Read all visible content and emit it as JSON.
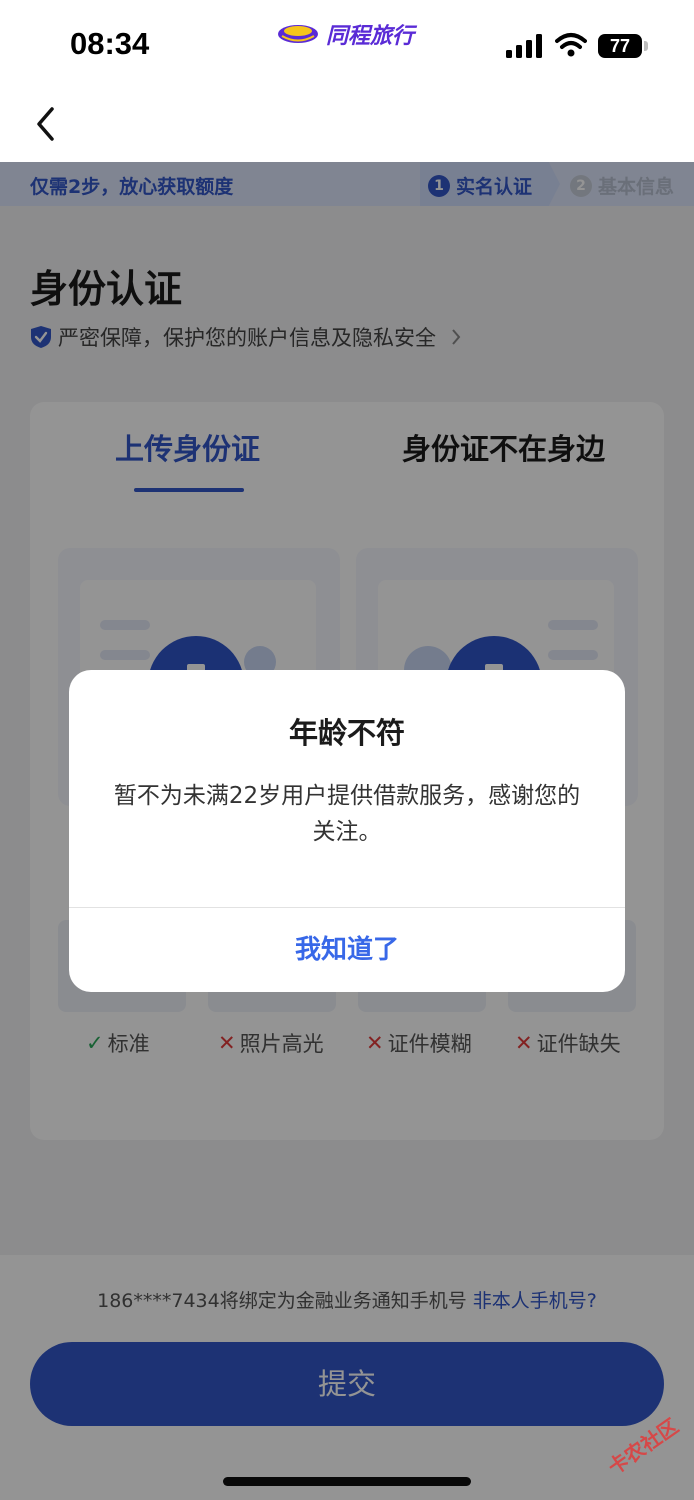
{
  "status_bar": {
    "time": "08:34",
    "brand": "同程旅行",
    "battery": "77"
  },
  "steps": {
    "tip": "仅需2步，放心获取额度",
    "items": [
      {
        "num": "1",
        "label": "实名认证"
      },
      {
        "num": "2",
        "label": "基本信息"
      }
    ]
  },
  "page": {
    "title": "身份认证",
    "security_note": "严密保障，保护您的账户信息及隐私安全"
  },
  "tabs": [
    {
      "label": "上传身份证"
    },
    {
      "label": "身份证不在身边"
    }
  ],
  "examples": [
    {
      "mark": "✓",
      "label": "标准"
    },
    {
      "mark": "✕",
      "label": "照片高光"
    },
    {
      "mark": "✕",
      "label": "证件模糊"
    },
    {
      "mark": "✕",
      "label": "证件缺失"
    }
  ],
  "footer": {
    "phone_text": "186****7434将绑定为金融业务通知手机号",
    "phone_link": "非本人手机号?",
    "submit_label": "提交"
  },
  "dialog": {
    "title": "年龄不符",
    "message": "暂不为未满22岁用户提供借款服务，感谢您的关注。",
    "confirm_label": "我知道了"
  },
  "watermark": "卡农社区",
  "colors": {
    "primary": "#3357c8",
    "link": "#3868e8",
    "ok": "#2aa85a",
    "error": "#e23b3b"
  }
}
